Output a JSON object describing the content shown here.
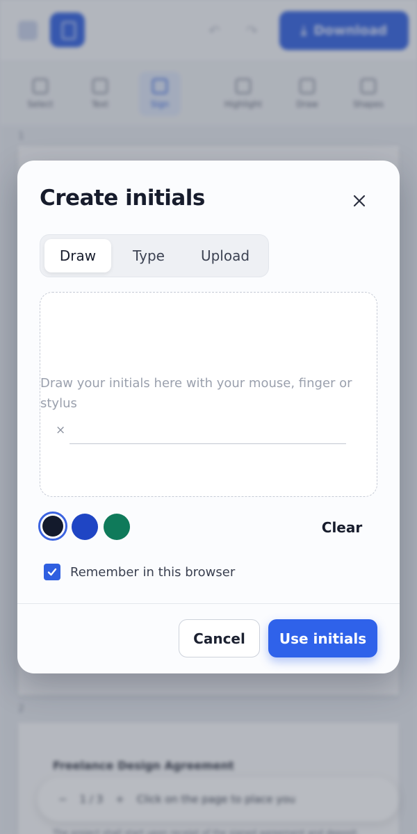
{
  "topbar": {
    "download_label": "Download"
  },
  "toolbar": {
    "tools": [
      {
        "label": "Select"
      },
      {
        "label": "Text"
      },
      {
        "label": "Sign"
      },
      {
        "label": "Highlight"
      },
      {
        "label": "Draw"
      },
      {
        "label": "Shapes"
      }
    ]
  },
  "document": {
    "page1_number": "1",
    "page2_number": "2",
    "page2_title": "Freelance Design Agreement",
    "page2_pill_zoom_minus": "−",
    "page2_pill_pages": "1 / 3",
    "page2_pill_zoom_plus": "+",
    "page2_pill_hint": "Click on the page to place you",
    "page2_paragraph": "The project shall start upon receipt of the signed agreement and deposit. Invoices are payable within fourteen days"
  },
  "modal": {
    "title": "Create initials",
    "tabs": [
      {
        "label": "Draw",
        "active": true
      },
      {
        "label": "Type",
        "active": false
      },
      {
        "label": "Upload",
        "active": false
      }
    ],
    "canvas_hint": "Draw your initials here with your mouse, finger or stylus",
    "canvas_mark": "×",
    "colors": {
      "black": "#131a2c",
      "blue": "#1f45c4",
      "green": "#0f7a5a",
      "accent": "#2f62ea"
    },
    "clear_label": "Clear",
    "remember_label": "Remember in this browser",
    "remember_checked": true,
    "cancel_label": "Cancel",
    "use_label": "Use initials"
  }
}
